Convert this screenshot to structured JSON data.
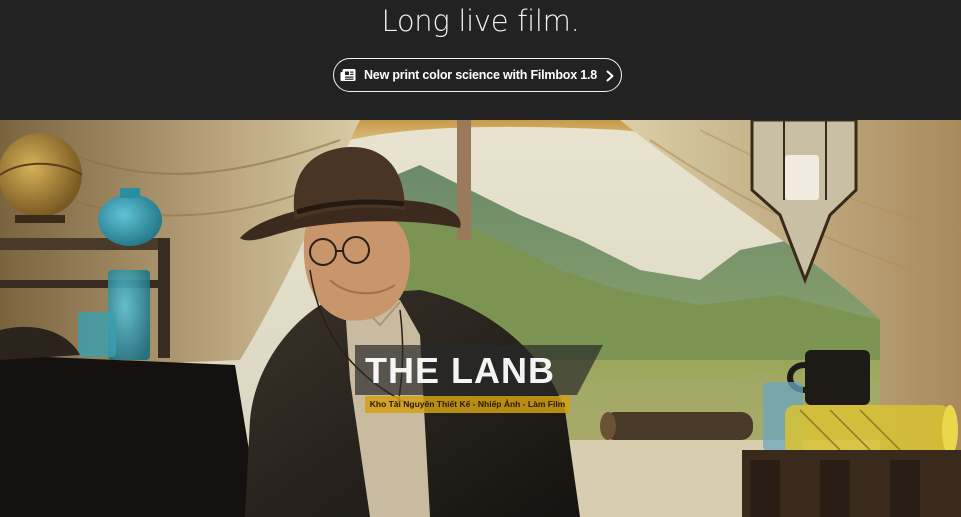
{
  "header": {
    "headline": "Long live film.",
    "announcement": {
      "label": "New print color science with Filmbox 1.8",
      "icon": "newspaper-icon",
      "chevron": "chevron-right-icon"
    }
  },
  "hero": {
    "watermark": {
      "logo_text": "THE LANB",
      "tagline": "Kho Tài Nguyên Thiết Kế - Nhiếp Ảnh - Làm Film"
    }
  },
  "colors": {
    "background": "#222222",
    "text": "#f2f2f2",
    "watermark_accent": "#d2a014"
  }
}
